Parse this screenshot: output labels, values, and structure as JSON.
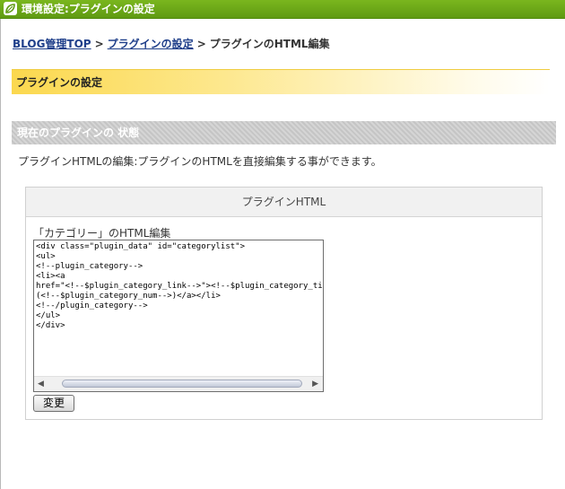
{
  "window": {
    "title": "環境設定:プラグインの設定"
  },
  "breadcrumb": {
    "items": [
      {
        "label": "BLOG管理TOP"
      },
      {
        "label": "プラグインの設定"
      }
    ],
    "separator": ">",
    "current": "プラグインのHTML編集"
  },
  "section": {
    "title": "プラグインの設定"
  },
  "status_header": {
    "title": "現在のプラグインの 状態"
  },
  "description": "プラグインHTMLの編集:プラグインのHTMLを直接編集する事ができます。",
  "panel": {
    "title": "プラグインHTML",
    "field_label": "「カテゴリー」のHTML編集",
    "code": "<div class=\"plugin_data\" id=\"categorylist\">\n<ul>\n<!--plugin_category-->\n<li><a\nhref=\"<!--$plugin_category_link-->\"><!--$plugin_category_title-->\n(<!--$plugin_category_num-->)</a></li>\n<!--/plugin_category-->\n</ul>\n</div>",
    "submit_label": "変更"
  },
  "colors": {
    "titlebar": "#6aa616",
    "link": "#1f3f8a",
    "section_yellow": "#fbd84e",
    "status_gray": "#c5c5c5"
  },
  "icons": {
    "app_logo": "leaf-logo-icon",
    "scroll_left": "arrow-left-icon",
    "scroll_right": "arrow-right-icon"
  }
}
